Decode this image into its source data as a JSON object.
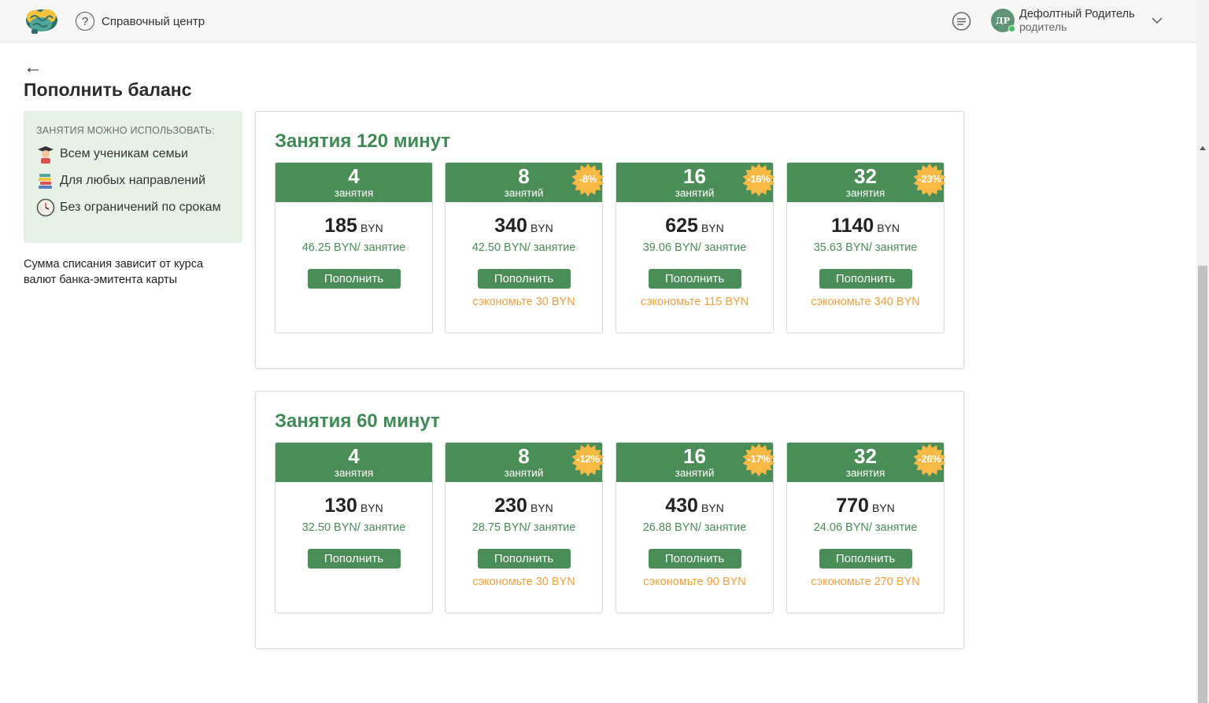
{
  "header": {
    "help_label": "Справочный центр",
    "user_name": "Дефолтный Родитель",
    "user_role": "родитель",
    "avatar_initials": "ДР"
  },
  "page": {
    "back_symbol": "←",
    "title": "Пополнить баланс"
  },
  "info": {
    "heading": "ЗАНЯТИЯ МОЖНО ИСПОЛЬЗОВАТЬ:",
    "items": [
      {
        "icon": "student-icon",
        "label": "Всем ученикам семьи"
      },
      {
        "icon": "books-icon",
        "label": "Для любых направлений"
      },
      {
        "icon": "clock-icon",
        "label": "Без ограничений по срокам"
      }
    ],
    "note": "Сумма списания зависит от курса валют банка-эмитента карты"
  },
  "plans": [
    {
      "title": "Занятия 120 минут",
      "cards": [
        {
          "count": "4",
          "unit": "занятия",
          "price": "185",
          "currency": "BYN",
          "per": "46.25 BYN/ занятие",
          "button": "Пополнить",
          "discount": "",
          "save": ""
        },
        {
          "count": "8",
          "unit": "занятий",
          "price": "340",
          "currency": "BYN",
          "per": "42.50 BYN/ занятие",
          "button": "Пополнить",
          "discount": "-8%",
          "save": "сэкономьте 30 BYN"
        },
        {
          "count": "16",
          "unit": "занятий",
          "price": "625",
          "currency": "BYN",
          "per": "39.06 BYN/ занятие",
          "button": "Пополнить",
          "discount": "-16%",
          "save": "сэкономьте 115 BYN"
        },
        {
          "count": "32",
          "unit": "занятия",
          "price": "1140",
          "currency": "BYN",
          "per": "35.63 BYN/ занятие",
          "button": "Пополнить",
          "discount": "-23%",
          "save": "сэкономьте 340 BYN"
        }
      ]
    },
    {
      "title": "Занятия 60 минут",
      "cards": [
        {
          "count": "4",
          "unit": "занятия",
          "price": "130",
          "currency": "BYN",
          "per": "32.50 BYN/ занятие",
          "button": "Пополнить",
          "discount": "",
          "save": ""
        },
        {
          "count": "8",
          "unit": "занятий",
          "price": "230",
          "currency": "BYN",
          "per": "28.75 BYN/ занятие",
          "button": "Пополнить",
          "discount": "-12%",
          "save": "сэкономьте 30 BYN"
        },
        {
          "count": "16",
          "unit": "занятий",
          "price": "430",
          "currency": "BYN",
          "per": "26.88 BYN/ занятие",
          "button": "Пополнить",
          "discount": "-17%",
          "save": "сэкономьте 90 BYN"
        },
        {
          "count": "32",
          "unit": "занятия",
          "price": "770",
          "currency": "BYN",
          "per": "24.06 BYN/ занятие",
          "button": "Пополнить",
          "discount": "-26%",
          "save": "сэкономьте 270 BYN"
        }
      ]
    }
  ],
  "colors": {
    "accent_green": "#4a8d57",
    "title_green": "#3f8a55",
    "savings_orange": "#f2a040",
    "badge_yellow": "#f8b945",
    "info_bg": "#e7f1e8"
  }
}
